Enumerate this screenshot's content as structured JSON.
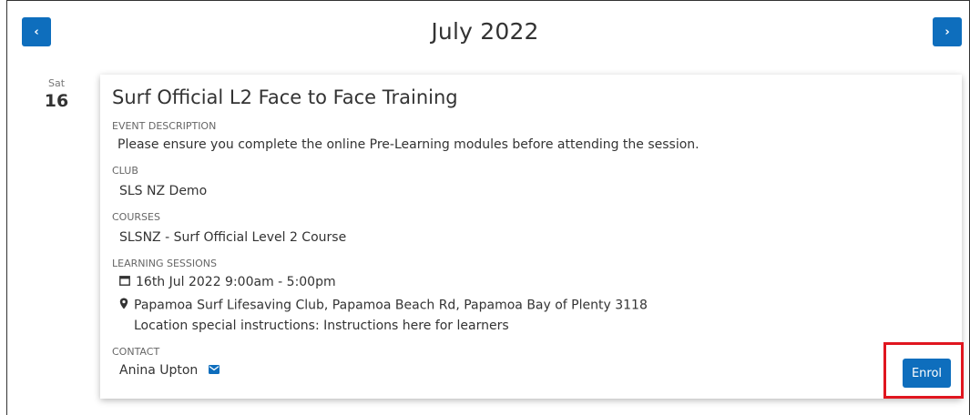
{
  "header": {
    "month_title": "July 2022",
    "prev_label": "‹",
    "next_label": "›"
  },
  "day": {
    "weekday": "Sat",
    "date": "16"
  },
  "event": {
    "title": "Surf Official L2 Face to Face Training",
    "description_label": "EVENT DESCRIPTION",
    "description": "Please ensure you complete the online Pre-Learning modules before attending the session.",
    "club_label": "CLUB",
    "club": "SLS NZ Demo",
    "courses_label": "COURSES",
    "courses": "SLSNZ - Surf Official Level 2 Course",
    "sessions_label": "LEARNING SESSIONS",
    "session_datetime": "16th Jul 2022 9:00am - 5:00pm",
    "session_location": "Papamoa Surf Lifesaving Club, Papamoa Beach Rd, Papamoa Bay of Plenty 3118",
    "session_instructions": "Location special instructions: Instructions here for learners",
    "contact_label": "CONTACT",
    "contact_name": "Anina Upton",
    "enrol_label": "Enrol"
  },
  "colors": {
    "accent": "#0e6ebd",
    "highlight": "#e0161f"
  },
  "icons": {
    "prev": "chevron-left-icon",
    "next": "chevron-right-icon",
    "calendar": "calendar-icon",
    "location": "map-pin-icon",
    "email": "envelope-icon"
  }
}
